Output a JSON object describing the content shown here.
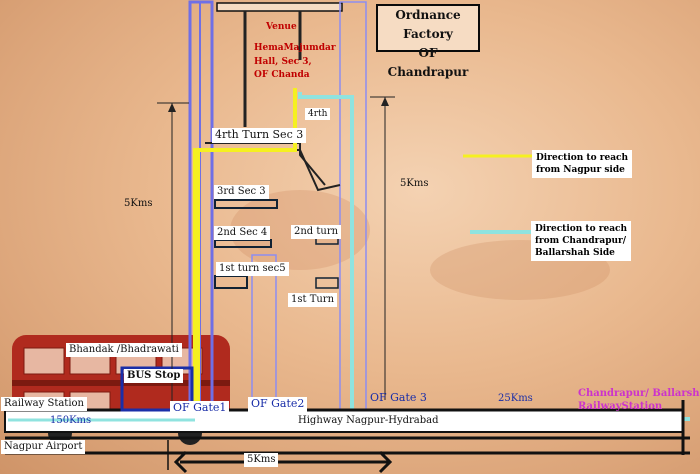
{
  "title": {
    "line1": "Ordnance Factory",
    "line2": "OF Chandrapur"
  },
  "venue": {
    "line1": "Venue",
    "line2": "HemaMajumdar",
    "line3": "Hall, Sec 3,",
    "line4": "OF Chanda"
  },
  "labels": {
    "fourth_turn_sec3": "4rth Turn Sec 3",
    "fourth": "4rth",
    "third_sec3": "3rd Sec 3",
    "second_sec4": "2nd Sec 4",
    "second_turn": "2nd turn",
    "first_turn_sec5": "1st turn sec5",
    "first_turn": "1st Turn",
    "bhandak": "Bhandak /Bhadrawati",
    "bus_stop": "BUS Stop",
    "of_gate1": "OF Gate1",
    "of_gate2": "OF Gate2",
    "of_gate3": "OF Gate 3",
    "railway_station": "Railway Station",
    "nagpur_airport": "Nagpur Airport",
    "highway": "Highway  Nagpur-Hydrabad",
    "chandrapur_ballarshah_1": "Chandrapur/ Ballarshah",
    "chandrapur_ballarshah_2": "RailwayStation"
  },
  "distances": {
    "left_vertical": "5Kms",
    "right_vertical": "5Kms",
    "bottom": "5Kms",
    "left_highway": "150Kms",
    "right_highway": "25Kms"
  },
  "legend": {
    "yellow_line1": "Direction to reach",
    "yellow_line2": "from Nagpur side",
    "cyan_line1": "Direction to reach",
    "cyan_line2": "from Chandrapur/",
    "cyan_line3": "Ballarshah Side"
  },
  "colors": {
    "nagpur_route": "#f5f020",
    "chandrapur_route": "#8fe3df",
    "road_blue": "#6f6fe6",
    "venue_text": "#c00000",
    "station_text": "#cc33cc"
  }
}
